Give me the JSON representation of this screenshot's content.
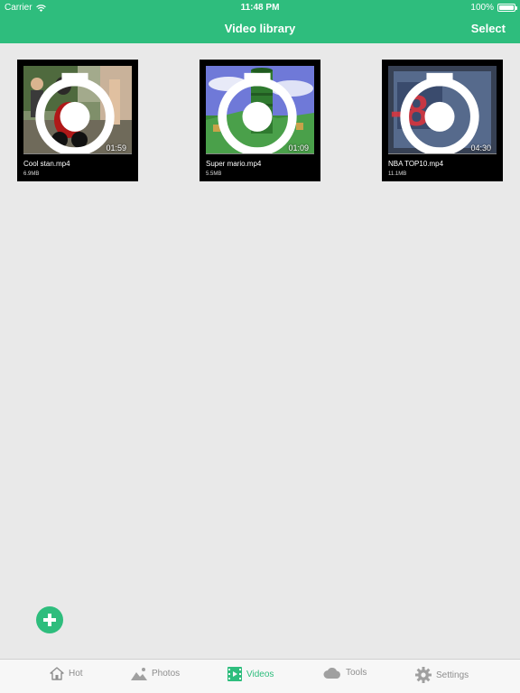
{
  "status": {
    "carrier": "Carrier",
    "time": "11:48 PM",
    "battery": "100%",
    "battery_level": 1.0
  },
  "header": {
    "title": "Video library",
    "select_label": "Select"
  },
  "videos": [
    {
      "name": "Cool stan.mp4",
      "size": "6.9MB",
      "duration": "01:59",
      "icon": "camera-icon"
    },
    {
      "name": "Super mario.mp4",
      "size": "5.5MB",
      "duration": "01:09",
      "icon": "camera-icon"
    },
    {
      "name": "NBA TOP10.mp4",
      "size": "11.1MB",
      "duration": "04:30",
      "icon": "camera-icon"
    }
  ],
  "fab": {
    "icon": "plus-icon"
  },
  "tabs": [
    {
      "label": "Hot",
      "icon": "home-icon",
      "active": false
    },
    {
      "label": "Photos",
      "icon": "photo-icon",
      "active": false
    },
    {
      "label": "Videos",
      "icon": "video-icon",
      "active": true
    },
    {
      "label": "Tools",
      "icon": "cloud-icon",
      "active": false
    },
    {
      "label": "Settings",
      "icon": "gear-icon",
      "active": false
    }
  ],
  "colors": {
    "accent": "#2ebd7d",
    "background": "#e9e9e9",
    "tab_inactive": "#8e8e8e"
  }
}
